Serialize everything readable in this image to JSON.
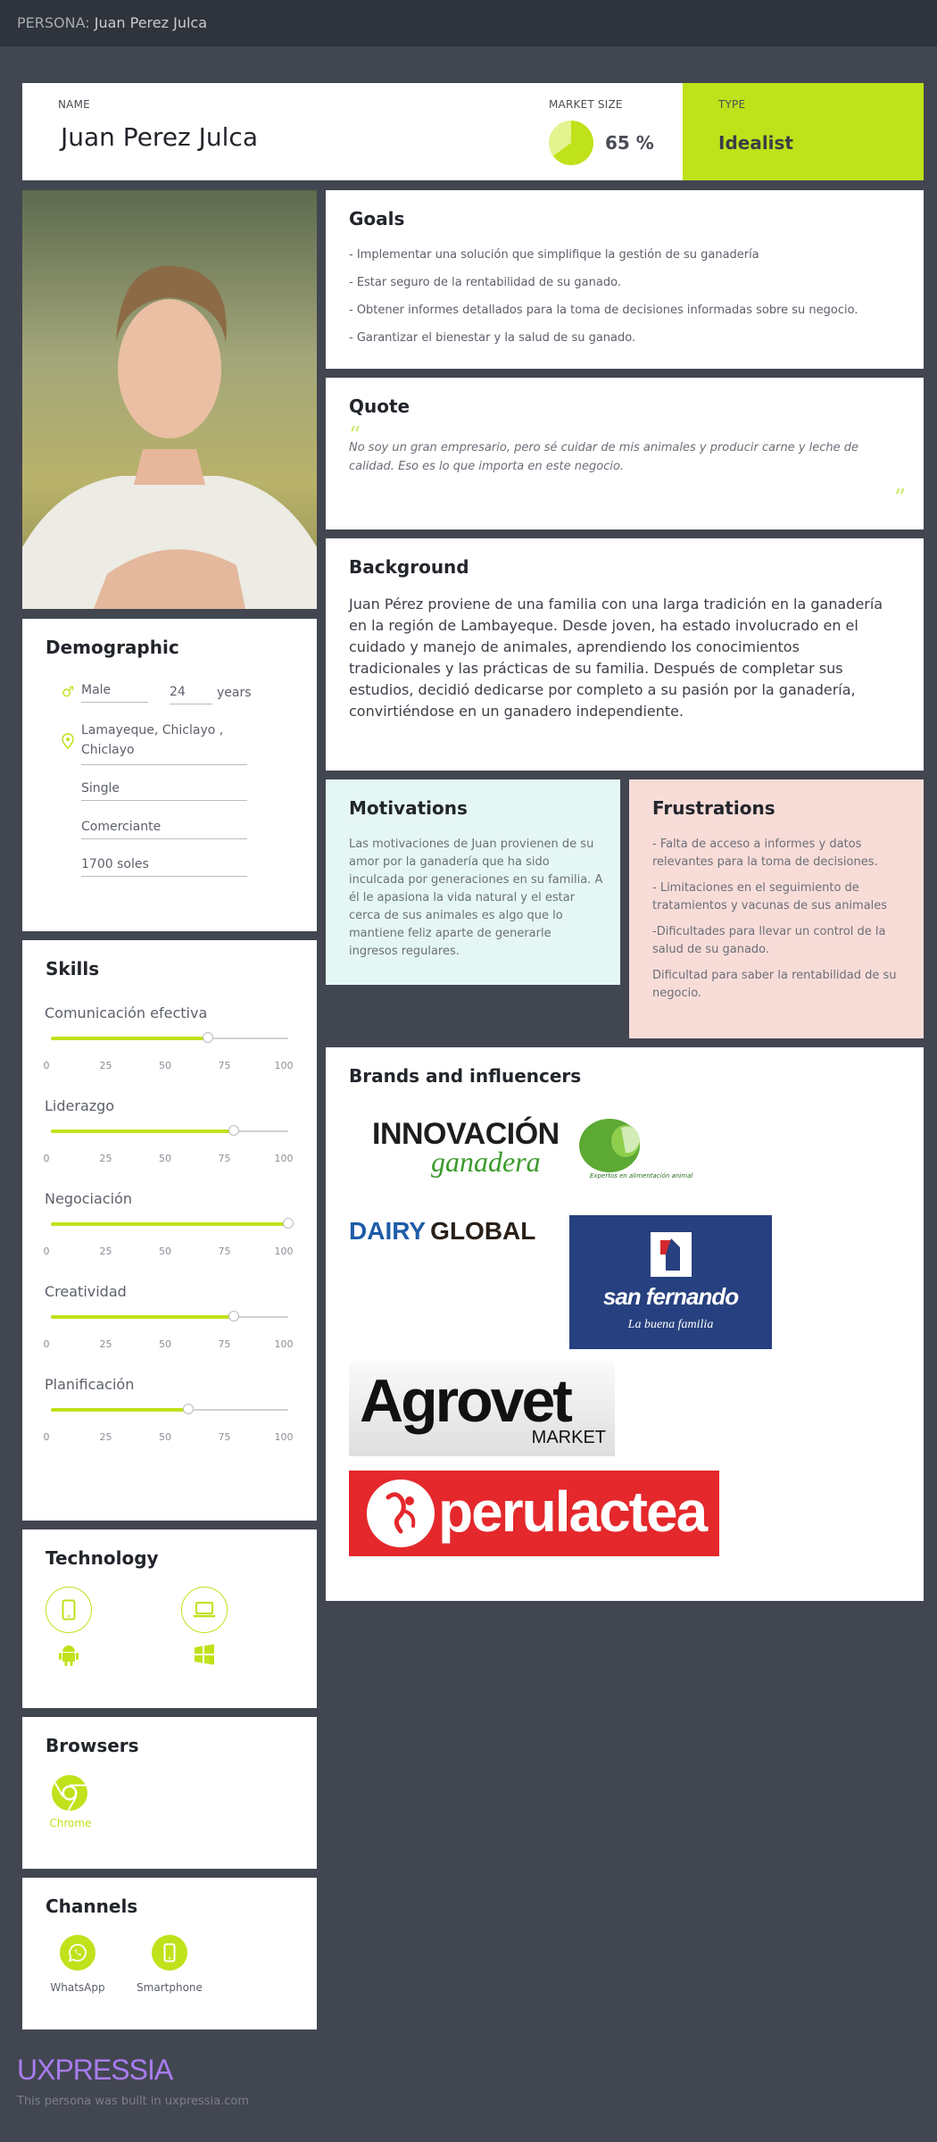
{
  "topbar": {
    "prefix": "PERSONA: ",
    "name": "Juan Perez Julca"
  },
  "header": {
    "name_label": "NAME",
    "name": "Juan Perez Julca",
    "market_label": "MARKET SIZE",
    "market_value": "65 %",
    "market_fraction": 0.65,
    "type_label": "TYPE",
    "type_value": "Idealist"
  },
  "goals": {
    "title": "Goals",
    "items": [
      "- Implementar una solución que simplifique la gestión de su ganadería",
      "- Estar seguro de la rentabilidad de su ganado.",
      "- Obtener informes detallados para la toma de decisiones informadas sobre su negocio.",
      "- Garantizar el bienestar y la salud de su ganado."
    ]
  },
  "quote": {
    "title": "Quote",
    "text": "No soy un gran empresario, pero sé cuidar de mis animales y producir carne y leche de calidad. Eso es lo que importa en este negocio."
  },
  "background": {
    "title": "Background",
    "text": "Juan Pérez proviene de una familia con una larga tradición en la ganadería en la región de Lambayeque. Desde joven, ha estado involucrado en el cuidado y manejo de animales, aprendiendo los conocimientos tradicionales y las prácticas de su familia. Después de completar sus estudios, decidió dedicarse por completo a su pasión por la ganadería, convirtiéndose en un ganadero independiente."
  },
  "demographic": {
    "title": "Demographic",
    "gender": "Male",
    "age": "24",
    "age_unit": "years",
    "location": "Lamayeque, Chiclayo , Chiclayo",
    "status": "Single",
    "occupation": "Comerciante",
    "income": "1700 soles"
  },
  "motivations": {
    "title": "Motivations",
    "text": "Las motivaciones de Juan provienen de su amor por la ganadería que ha sido inculcada por generaciones en su familia. A él le apasiona la vida natural y el estar cerca de sus animales es algo que lo mantiene feliz aparte de generarle ingresos regulares."
  },
  "frustrations": {
    "title": "Frustrations",
    "items": [
      "- Falta de acceso a informes y datos relevantes para la toma de decisiones.",
      "- Limitaciones en el seguimiento de tratamientos y vacunas de sus animales",
      "-Dificultades para llevar un control de la salud de su ganado.",
      "Dificultad para saber la rentabilidad de su negocio."
    ]
  },
  "skills": {
    "title": "Skills",
    "ticks": [
      "0",
      "25",
      "50",
      "75",
      "100"
    ],
    "items": [
      {
        "name": "Comunicación efectiva",
        "value": 66
      },
      {
        "name": "Liderazgo",
        "value": 77
      },
      {
        "name": "Negociación",
        "value": 100
      },
      {
        "name": "Creatividad",
        "value": 77
      },
      {
        "name": "Planificación",
        "value": 58
      }
    ]
  },
  "technology": {
    "title": "Technology",
    "icons": [
      "smartphone-icon",
      "laptop-icon",
      "android-icon",
      "windows-icon"
    ]
  },
  "browsers": {
    "title": "Browsers",
    "chrome": "Chrome"
  },
  "channels": {
    "title": "Channels",
    "whatsapp": "WhatsApp",
    "smartphone": "Smartphone"
  },
  "brands": {
    "title": "Brands and influencers",
    "innovacion_1": "INNOVACIÓN",
    "innovacion_2": "ganadera",
    "innovacion_3": "Expertos en alimentación animal",
    "dairy_1": "DAIRY",
    "dairy_2": "GLOBAL",
    "sanfernando_1": "san fernando",
    "sanfernando_2": "La buena familia",
    "agrovet_1": "Agrovet",
    "agrovet_2": "MARKET",
    "perulactea": "perulactea"
  },
  "footer": {
    "brand": "UXPRESSIA",
    "note": "This persona was built in uxpressia.com"
  },
  "colors": {
    "accent": "#bfe21a",
    "background": "#424650",
    "topbar": "#2f333b",
    "motivations": "#e5f7f3",
    "frustrations": "#f8dcd8",
    "brand_purple": "#a97cf0"
  }
}
